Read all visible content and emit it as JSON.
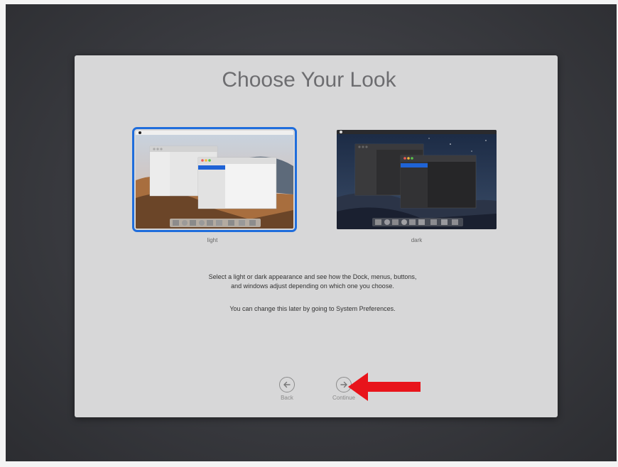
{
  "setup": {
    "title": "Choose Your Look",
    "options": [
      {
        "label": "light",
        "selected": true
      },
      {
        "label": "dark",
        "selected": false
      }
    ],
    "description_line1": "Select a light or dark appearance and see how the Dock, menus, buttons,",
    "description_line2": "and windows adjust depending on which one you choose.",
    "note": "You can change this later by going to System Preferences.",
    "back_label": "Back",
    "continue_label": "Continue"
  },
  "colors": {
    "selection_ring": "#1f6ddc",
    "annotation_arrow": "#e8141b",
    "panel": "#d7d7d8"
  },
  "icons": [
    "arrow-left-circle-icon",
    "arrow-right-circle-icon",
    "red-pointer-arrow"
  ]
}
